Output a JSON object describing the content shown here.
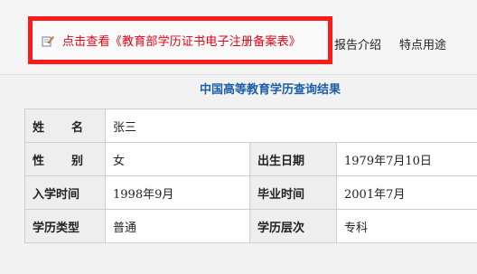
{
  "notice": {
    "link_text": "点击查看《教育部学历证书电子注册备案表》",
    "icon": "edit-note-icon",
    "border_color": "#ff1a1a",
    "text_color": "#e60012"
  },
  "tabs": {
    "report_intro": "报告介绍",
    "features": "特点用途"
  },
  "result": {
    "title": "中国高等教育学历查询结果",
    "title_color": "#1a5ea8"
  },
  "table": {
    "name_label": [
      "姓",
      "名"
    ],
    "name_value": "张三",
    "gender_label": [
      "性",
      "别"
    ],
    "gender_value": "女",
    "birth_label": "出生日期",
    "birth_value": "1979年7月10日",
    "enroll_label": "入学时间",
    "enroll_value": "1998年9月",
    "graduate_label": "毕业时间",
    "graduate_value": "2001年7月",
    "edu_type_label": "学历类型",
    "edu_type_value": "普通",
    "edu_level_label": "学历层次",
    "edu_level_value": "专科"
  }
}
